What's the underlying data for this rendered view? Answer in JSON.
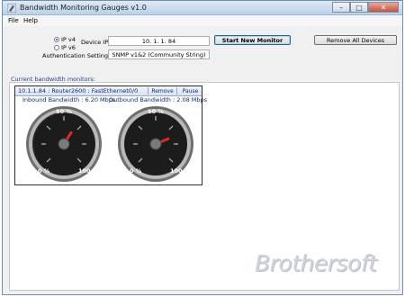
{
  "window": {
    "title": "Bandwidth Monitoring Gauges v1.0",
    "minimize": "–",
    "maximize": "□",
    "close": "✕"
  },
  "menu": [
    {
      "label": "File"
    },
    {
      "label": "Help"
    }
  ],
  "form": {
    "ipv4_label": "IP v4",
    "ipv6_label": "IP v6",
    "ip_version_selected": "IP v4",
    "device_ip_label": "Device IP:",
    "device_ip_value": "10.  1.   1. 84",
    "auth_label": "Authentication Settings:",
    "auth_value": "SNMP v1&2 (Community String)",
    "start_button": "Start New Monitor",
    "remove_all_button": "Remove All Devices"
  },
  "monitors_section_label": "Current bandwidth monitors:",
  "monitors": [
    {
      "title": "10.1.1.84  :  Router2600  :  FastEthernet0/0",
      "remove": "Remove",
      "pause": "Pause",
      "inbound": {
        "label": "Inbound Bandwidth : 6.20 Mbps",
        "mid_label": "50 %",
        "min_label": "0 %",
        "max_label": "100 %",
        "needle_percent": 62
      },
      "outbound": {
        "label": "Outbound Bandwidth : 2.08 Mbps",
        "mid_label": "50 %",
        "min_label": "0 %",
        "max_label": "100 %",
        "needle_percent": 75
      }
    }
  ],
  "watermark": "Brothersoft",
  "colors": {
    "needle": "#e0281e",
    "gauge_face": "#1c1c1c",
    "gauge_ring": "#8a8a8a",
    "title_blue": "#0b2e78"
  }
}
